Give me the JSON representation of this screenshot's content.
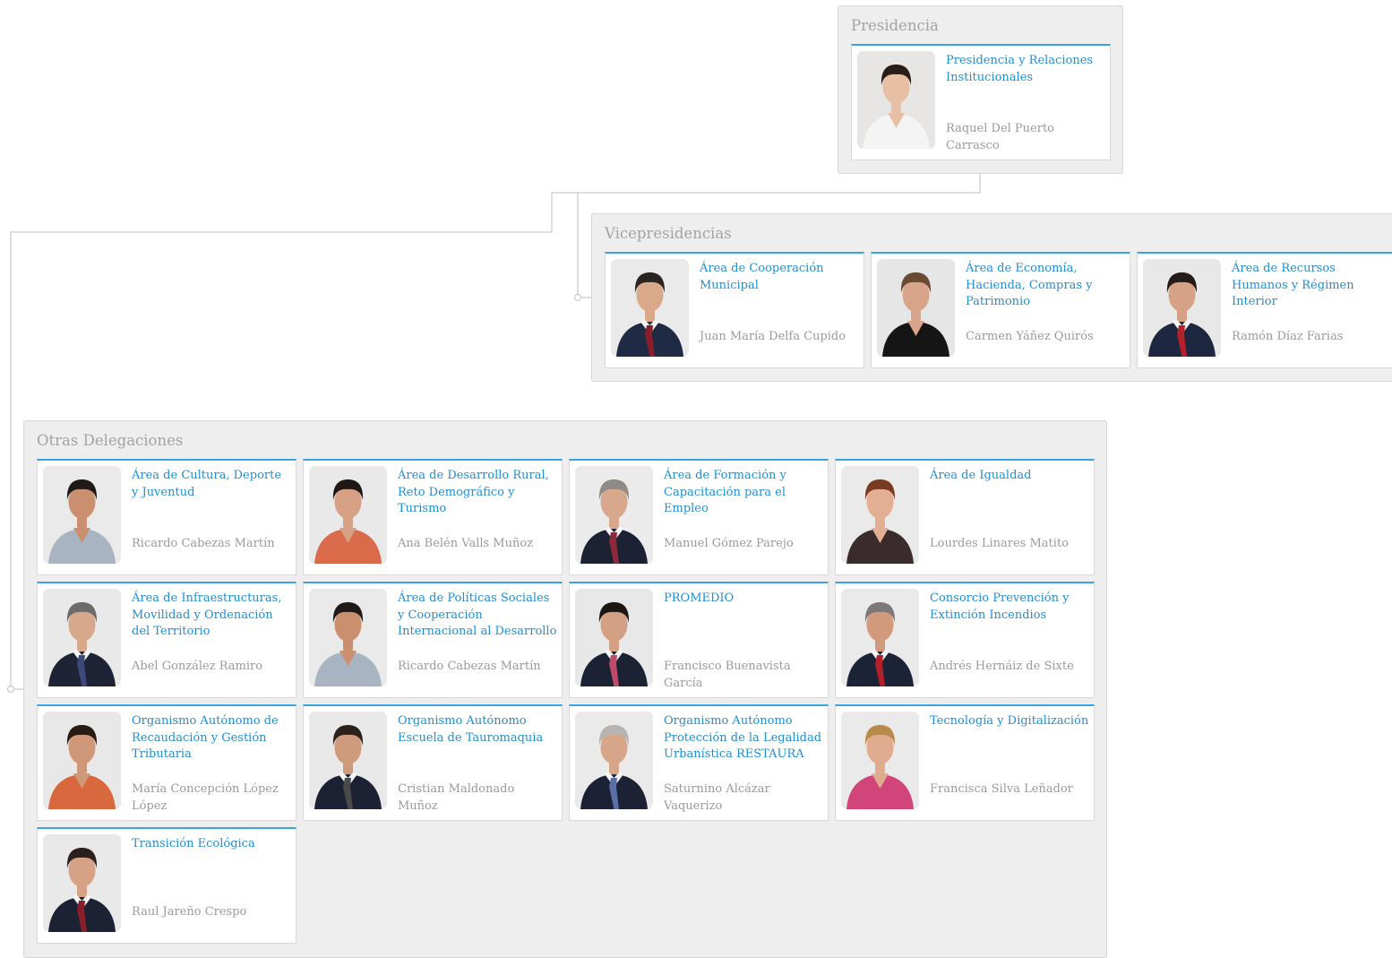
{
  "groups": {
    "presidencia": {
      "title": "Presidencia",
      "cards": [
        {
          "area": "Presidencia y Relaciones Institucionales",
          "person": "Raquel Del Puerto Carrasco",
          "photo": {
            "bg": "#e8e6e4",
            "skin": "#e6bfa5",
            "hair": "#2a1d18",
            "clothes": "#f4f4f4",
            "tie": ""
          }
        }
      ]
    },
    "vicepresidencias": {
      "title": "Vicepresidencias",
      "cards": [
        {
          "area": "Área de Cooperación Municipal",
          "person": "Juan María Delfa Cupido",
          "photo": {
            "bg": "#eaeaea",
            "skin": "#d9a98a",
            "hair": "#2b2522",
            "clothes": "#1f2a44",
            "tie": "#8b1e2b"
          }
        },
        {
          "area": "Área de Economía, Hacienda, Compras y Patrimonio",
          "person": "Carmen Yáñez Quirós",
          "photo": {
            "bg": "#e6e6e6",
            "skin": "#d9a58a",
            "hair": "#6a4a33",
            "clothes": "#151515",
            "tie": ""
          }
        },
        {
          "area": "Área de Recursos Humanos y Régimen Interior",
          "person": "Ramón Díaz Farias",
          "photo": {
            "bg": "#e8e8e8",
            "skin": "#d6a184",
            "hair": "#231c19",
            "clothes": "#1e2740",
            "tie": "#b3202c"
          }
        }
      ]
    },
    "otras": {
      "title": "Otras Delegaciones",
      "cards": [
        {
          "area": "Área de Cultura, Deporte y Juventud",
          "person": "Ricardo Cabezas Martín",
          "photo": {
            "bg": "#eaeaea",
            "skin": "#c98f6e",
            "hair": "#1f1a17",
            "clothes": "#a9b4c2",
            "tie": ""
          }
        },
        {
          "area": "Área de Desarrollo Rural, Reto Demográfico y Turismo",
          "person": "Ana Belén Valls Muñoz",
          "photo": {
            "bg": "#e9e9e9",
            "skin": "#d5a084",
            "hair": "#1f1815",
            "clothes": "#d96a4a",
            "tie": ""
          }
        },
        {
          "area": "Área de Formación y Capacitación para el Empleo",
          "person": "Manuel Gómez Parejo",
          "photo": {
            "bg": "#ebebeb",
            "skin": "#d8a88c",
            "hair": "#8d8a87",
            "clothes": "#1c2233",
            "tie": "#8b2a3a"
          }
        },
        {
          "area": "Área de Igualdad",
          "person": "Lourdes Linares Matito",
          "photo": {
            "bg": "#eaeaea",
            "skin": "#e2ae94",
            "hair": "#7a3a22",
            "clothes": "#3a2c2c",
            "tie": ""
          }
        },
        {
          "area": "Área de Infraestructuras, Movilidad y Ordenación del Territorio",
          "person": "Abel González Ramiro",
          "photo": {
            "bg": "#e9e9e9",
            "skin": "#d7a88c",
            "hair": "#6d6b69",
            "clothes": "#1e2335",
            "tie": "#3b4a7a"
          }
        },
        {
          "area": "Área de Políticas Sociales y Cooperación Internacional al Desarrollo",
          "person": "Ricardo Cabezas Martín",
          "photo": {
            "bg": "#eaeaea",
            "skin": "#c98f6e",
            "hair": "#1f1a17",
            "clothes": "#a9b4c2",
            "tie": ""
          }
        },
        {
          "area": "PROMEDIO",
          "person": "Francisco Buenavista García",
          "photo": {
            "bg": "#e8e8e8",
            "skin": "#d3a083",
            "hair": "#1d1714",
            "clothes": "#1b2234",
            "tie": "#c04a6a"
          }
        },
        {
          "area": "Consorcio Prevención y Extinción Incendios",
          "person": "Andrés Hernáiz de Sixte",
          "photo": {
            "bg": "#eaeaea",
            "skin": "#d29a7d",
            "hair": "#7c7a78",
            "clothes": "#1c2336",
            "tie": "#b3202c"
          }
        },
        {
          "area": "Organismo Autónomo de Recaudación y Gestión Tributaria",
          "person": "María Concepción López López",
          "photo": {
            "bg": "#e8e8e8",
            "skin": "#cf9879",
            "hair": "#2a1a14",
            "clothes": "#d9683e",
            "tie": ""
          }
        },
        {
          "area": "Organismo Autónomo Escuela de Tauromaquia",
          "person": "Cristian Maldonado Muñoz",
          "photo": {
            "bg": "#e9e9e9",
            "skin": "#cf9a7c",
            "hair": "#2a211c",
            "clothes": "#1c2233",
            "tie": "#4a4a4a"
          }
        },
        {
          "area": "Organismo Autónomo Protección de la Legalidad Urbanística RESTAURA",
          "person": "Saturnino Alcázar Vaquerizo",
          "photo": {
            "bg": "#eaeaea",
            "skin": "#d7a689",
            "hair": "#b7b4b1",
            "clothes": "#1c2233",
            "tie": "#5a6fa8"
          }
        },
        {
          "area": "Tecnología y Digitalización",
          "person": "Francisca Silva Leñador",
          "photo": {
            "bg": "#eaeaea",
            "skin": "#e0ac90",
            "hair": "#b98a4a",
            "clothes": "#d2457a",
            "tie": ""
          }
        },
        {
          "area": "Transición Ecológica",
          "person": "Raul Jareño Crespo",
          "photo": {
            "bg": "#e9e9e9",
            "skin": "#d6a184",
            "hair": "#2b211c",
            "clothes": "#1c2233",
            "tie": "#8b1e2b"
          }
        }
      ]
    }
  }
}
